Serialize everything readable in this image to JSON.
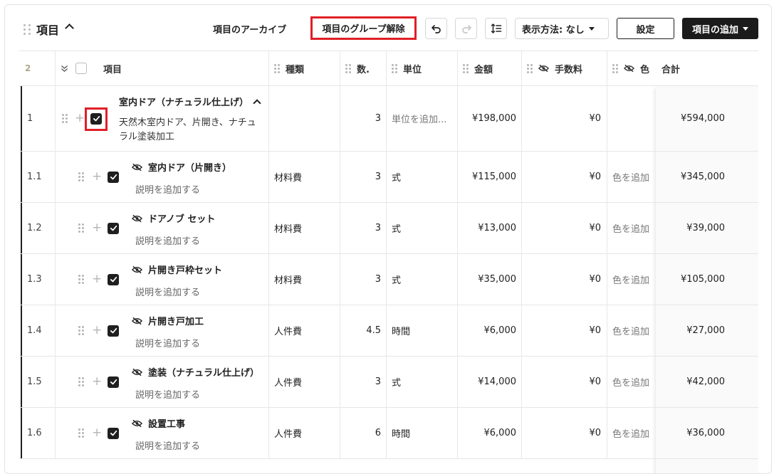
{
  "header": {
    "title": "項目",
    "archive_label": "項目のアーカイブ",
    "ungroup_label": "項目のグループ解除",
    "display_label": "表示方法: なし",
    "settings_label": "設定",
    "add_label": "項目の追加"
  },
  "columns": {
    "count": "2",
    "item": "項目",
    "type": "種類",
    "qty": "数.",
    "unit": "単位",
    "amount": "金額",
    "fee": "手数料",
    "color": "色",
    "total": "合計"
  },
  "group_row": {
    "number": "1",
    "name": "室内ドア（ナチュラル仕上げ）",
    "description": "天然木室内ドア、片開き、ナチュラル塗装加工",
    "qty": "3",
    "unit_placeholder": "単位を追加...",
    "amount": "¥198,000",
    "fee": "¥0",
    "total": "¥594,000"
  },
  "rows": [
    {
      "number": "1.1",
      "name": "室内ドア（片開き）",
      "desc": "説明を追加する",
      "type": "材料費",
      "qty": "3",
      "unit": "式",
      "amount": "¥115,000",
      "fee": "¥0",
      "color": "色を追加",
      "total": "¥345,000"
    },
    {
      "number": "1.2",
      "name": "ドアノブ セット",
      "desc": "説明を追加する",
      "type": "材料費",
      "qty": "3",
      "unit": "式",
      "amount": "¥13,000",
      "fee": "¥0",
      "color": "色を追加",
      "total": "¥39,000"
    },
    {
      "number": "1.3",
      "name": "片開き戸枠セット",
      "desc": "説明を追加する",
      "type": "材料費",
      "qty": "3",
      "unit": "式",
      "amount": "¥35,000",
      "fee": "¥0",
      "color": "色を追加",
      "total": "¥105,000"
    },
    {
      "number": "1.4",
      "name": "片開き戸加工",
      "desc": "説明を追加する",
      "type": "人件費",
      "qty": "4.5",
      "unit": "時間",
      "amount": "¥6,000",
      "fee": "¥0",
      "color": "色を追加",
      "total": "¥27,000"
    },
    {
      "number": "1.5",
      "name": "塗装（ナチュラル仕上げ）",
      "desc": "説明を追加する",
      "type": "人件費",
      "qty": "3",
      "unit": "式",
      "amount": "¥14,000",
      "fee": "¥0",
      "color": "色を追加",
      "total": "¥42,000"
    },
    {
      "number": "1.6",
      "name": "設置工事",
      "desc": "説明を追加する",
      "type": "人件費",
      "qty": "6",
      "unit": "時間",
      "amount": "¥6,000",
      "fee": "¥0",
      "color": "色を追加",
      "total": "¥36,000"
    }
  ],
  "colors": {
    "highlight": "#e01f26",
    "primary": "#1b1b1b"
  }
}
